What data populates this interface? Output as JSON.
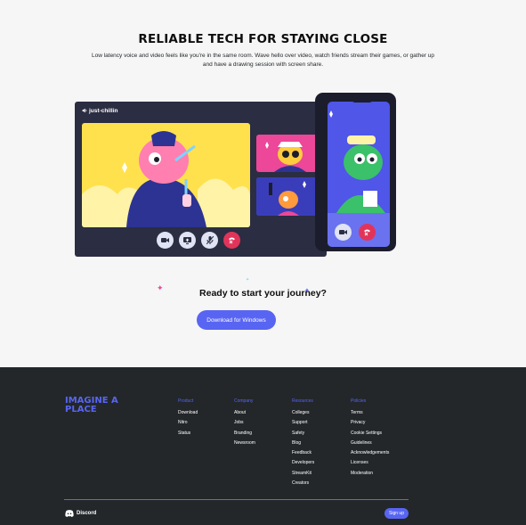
{
  "hero": {
    "title": "RELIABLE TECH FOR STAYING CLOSE",
    "description": "Low latency voice and video feels like you're in the same room. Wave hello over video, watch friends stream their games, or gather up and have a drawing session with screen share."
  },
  "call": {
    "channel_name": "just-chillin",
    "controls": [
      "video-icon",
      "screen-share-icon",
      "mute-icon",
      "hang-up-icon"
    ]
  },
  "cta": {
    "title": "Ready to start your journey?",
    "download_label": "Download for Windows"
  },
  "footer": {
    "tagline": "IMAGINE A PLACE",
    "columns": [
      {
        "heading": "Product",
        "items": [
          "Download",
          "Nitro",
          "Status"
        ]
      },
      {
        "heading": "Company",
        "items": [
          "About",
          "Jobs",
          "Branding",
          "Newsroom"
        ]
      },
      {
        "heading": "Resources",
        "items": [
          "Colleges",
          "Support",
          "Safety",
          "Blog",
          "Feedback",
          "Developers",
          "StreamKit",
          "Creators"
        ]
      },
      {
        "heading": "Policies",
        "items": [
          "Terms",
          "Privacy",
          "Cookie Settings",
          "Guidelines",
          "Acknowledgements",
          "Licenses",
          "Moderation"
        ]
      }
    ],
    "brand": "Discord",
    "signup_label": "Sign up"
  },
  "colors": {
    "blurple": "#5865f2",
    "footer_bg": "#23272a",
    "call_bg": "#2b2d42",
    "hang_up": "#e2345a",
    "tile_yellow": "#ffe14d",
    "tile_pink": "#ec4799"
  }
}
